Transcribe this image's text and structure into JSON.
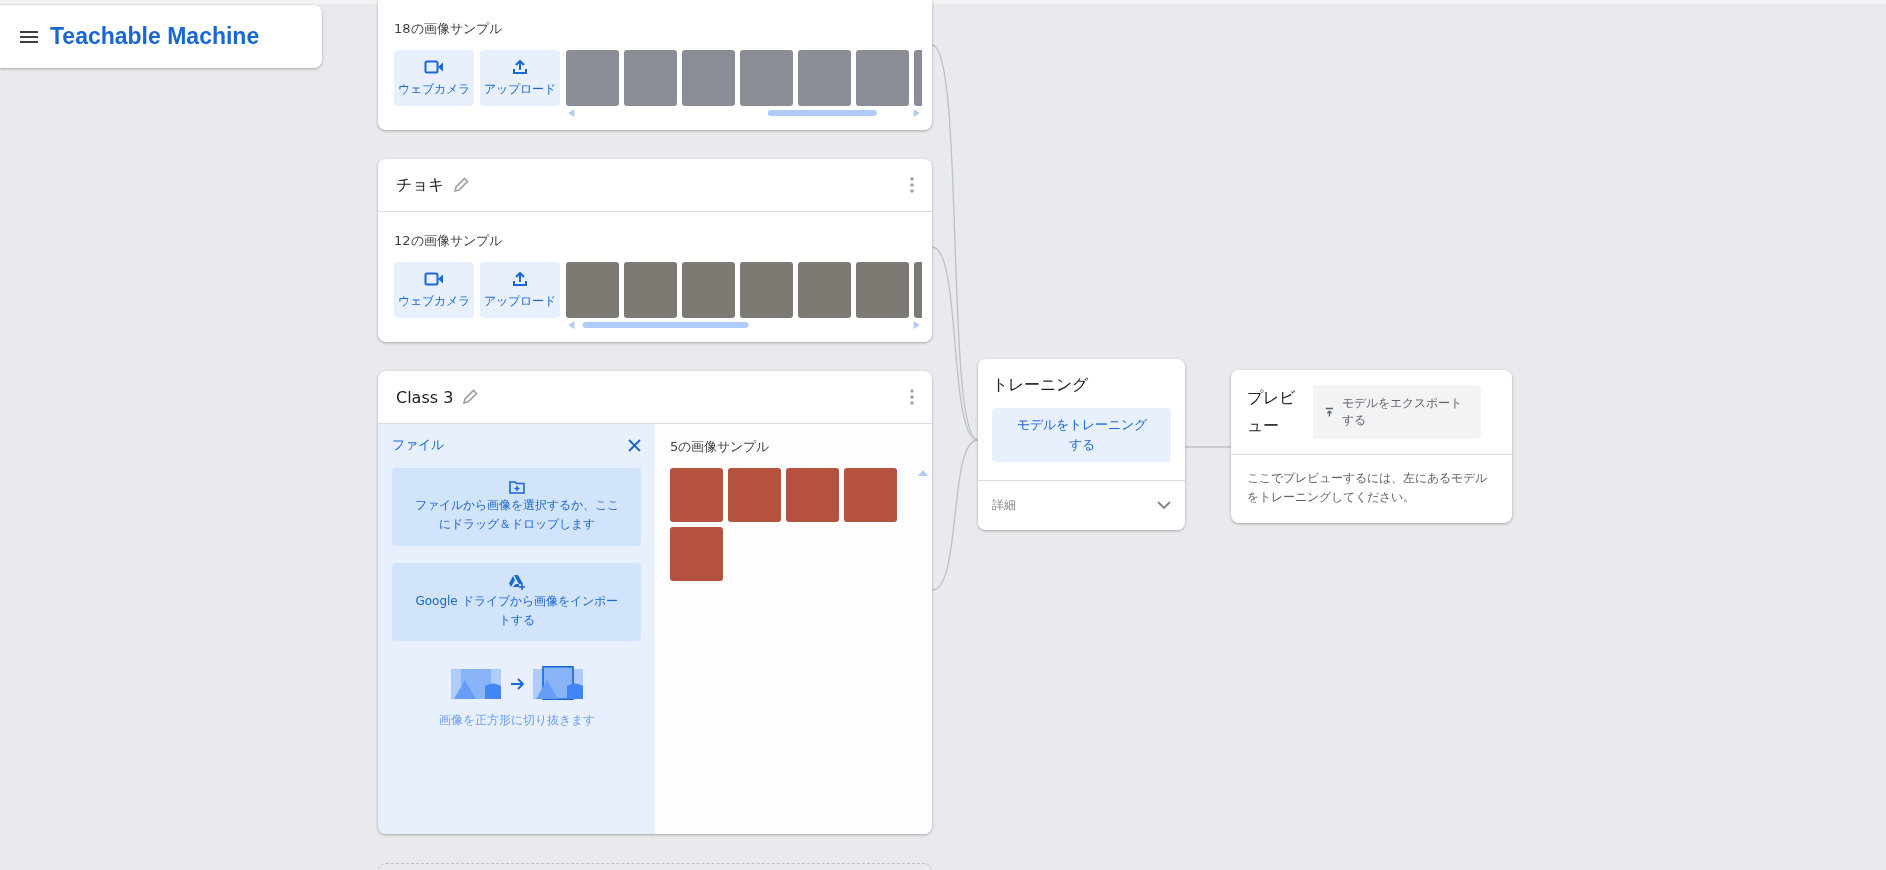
{
  "app": {
    "title": "Teachable Machine"
  },
  "classes": [
    {
      "kind": "samples",
      "samples_label": "18の画像サンプル",
      "buttons": [
        "ウェブカメラ",
        "アップロード"
      ]
    },
    {
      "kind": "samples",
      "name": "チョキ",
      "samples_label": "12の画像サンプル",
      "buttons": [
        "ウェブカメラ",
        "アップロード"
      ]
    },
    {
      "kind": "file_upload",
      "name": "Class 3",
      "samples_label": "5の画像サンプル",
      "file_panel": {
        "title": "ファイル",
        "options": [
          {
            "kind": "file",
            "label": "ファイルから画像を選択するか、ここにドラッグ＆ドロップします"
          },
          {
            "kind": "drive",
            "label": "Google ドライブから画像をインポートする"
          }
        ],
        "crop_note": "画像を正方形に切り抜きます"
      }
    }
  ],
  "training": {
    "title": "トレーニング",
    "button": "モデルをトレーニングする",
    "advanced": "詳細",
    "expanded": false
  },
  "preview": {
    "title": "プレビュー",
    "export_button": "モデルをエクスポートする",
    "message": "ここでプレビューするには、左にあるモデルをトレーニングしてください。"
  }
}
